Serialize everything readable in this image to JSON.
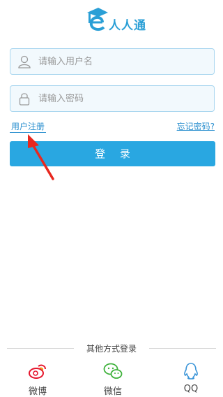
{
  "app": {
    "logo_text": "人人通",
    "logo_icon": "graduation-e-icon"
  },
  "form": {
    "username_placeholder": "请输入用户名",
    "password_placeholder": "请输入密码",
    "username_value": "",
    "password_value": ""
  },
  "links": {
    "register": "用户注册",
    "forgot": "忘记密码?"
  },
  "login_button": "登 录",
  "other_login": {
    "title": "其他方式登录",
    "providers": [
      {
        "label": "微博",
        "icon": "weibo-icon"
      },
      {
        "label": "微信",
        "icon": "wechat-icon"
      },
      {
        "label": "QQ",
        "icon": "qq-icon"
      }
    ]
  },
  "colors": {
    "accent": "#29a7e1",
    "link": "#2a8fcf",
    "field_bg": "#f2f9fd",
    "field_border": "#a9d6ef",
    "arrow": "#e8281f"
  }
}
